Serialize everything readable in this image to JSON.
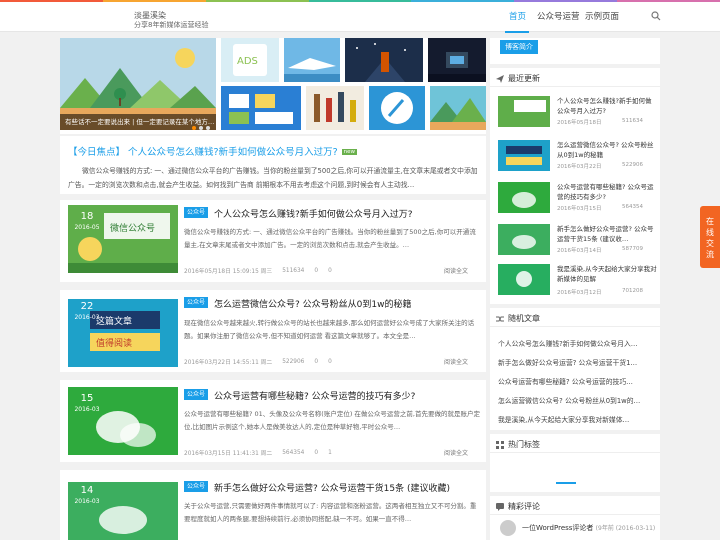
{
  "header": {
    "site_title": "淡墨溪染",
    "site_subtitle": "分享8年新媒体运营经验",
    "nav": [
      "首页",
      "公众号运营",
      "示例页面"
    ],
    "accent": "#1a9ee8"
  },
  "banner": {
    "caption": "有些话不一定要说出来 | 但一定要记录在某个地方…"
  },
  "focus": {
    "title": "【今日焦点】 个人公众号怎么赚钱?新手如何做公众号月入过万?",
    "badge": "new",
    "text": "微信公众号赚钱的方式: 一、通过微信公众平台的广告赚钱。当你的粉丝量到了500之后,你可以开通流量主,在文章末尾或者文中添加广告。一定的浏览次数和点击,就会产生收益。如何找到广告商 前期根本不用去考虑这个问题,到时候会有人主动找…"
  },
  "articles": [
    {
      "day": "18",
      "ym": "2016-05",
      "category": "公众号",
      "title": "个人公众号怎么赚钱?新手如何做公众号月入过万?",
      "excerpt": "微信公众号赚钱的方式: 一、通过微信公众平台的广告赚钱。当你的粉丝量到了500之后,你可以开通流量主,在文章末尾或者文中添加广告。一定的浏览次数和点击,就会产生收益。…",
      "date": "2016年05月18日 15:09:15 周三",
      "views": "511634",
      "comments": "0",
      "likes": "0",
      "more": "阅读全文"
    },
    {
      "day": "22",
      "ym": "2016-03",
      "category": "公众号",
      "title": "怎么运营微信公众号? 公众号粉丝从0到1w的秘籍",
      "excerpt": "现在微信公众号越来越火,转行做公众号的站长也越来越多,那么如何运营好公众号成了大家所关注的话题。如果你注册了微信公众号,但不知道如何运营 看这篇文章就够了。本文全是…",
      "date": "2016年03月22日 14:55:11 周二",
      "views": "522906",
      "comments": "0",
      "likes": "0",
      "more": "阅读全文"
    },
    {
      "day": "15",
      "ym": "2016-03",
      "category": "公众号",
      "title": "公众号运营有哪些秘籍? 公众号运营的技巧有多少?",
      "excerpt": "公众号运营有哪些秘籍? 01、头像及公众号名称(账户定位) 在做公众号运营之前,首先要做的就是账户定位,比如图片示例这个,她本人是做美妆达人的,定位是种草好物,平时公众号…",
      "date": "2016年03月15日 11:41:31 周二",
      "views": "564354",
      "comments": "0",
      "likes": "1",
      "more": "阅读全文"
    },
    {
      "day": "14",
      "ym": "2016-03",
      "category": "公众号",
      "title": "新手怎么做好公众号运营? 公众号运营干货15条 (建议收藏)",
      "excerpt": "关于公众号运营,只需要做好两件事情就可以了: 内容运营和涨粉运营。这两者相互独立又不可分割。重要程度就如人的两条腿,要想持续前行,必须协同搭配,缺一不可。如果一直不得…",
      "date": "2016年03月14日",
      "views": "",
      "comments": "",
      "likes": "",
      "more": ""
    }
  ],
  "sidebar": {
    "blog_intro": "博客简介",
    "recent_heading": "最近更新",
    "recent": [
      {
        "title": "个人公众号怎么赚钱?新手如何做公众号月入过万?",
        "date": "2016年05月18日",
        "views": "511634"
      },
      {
        "title": "怎么运营微信公众号? 公众号粉丝从0到1w的秘籍",
        "date": "2016年03月22日",
        "views": "522906"
      },
      {
        "title": "公众号运营有哪些秘籍? 公众号运营的技巧有多少?",
        "date": "2016年03月15日",
        "views": "564354"
      },
      {
        "title": "新手怎么做好公众号运营? 公众号运营干货15条 (建议收…",
        "date": "2016年03月14日",
        "views": "587709"
      },
      {
        "title": "我是溪染,从今天起给大家分享我对新媒体的见解",
        "date": "2016年03月12日",
        "views": "701208"
      }
    ],
    "random_heading": "随机文章",
    "random": [
      "个人公众号怎么赚钱?新手如何做公众号月入…",
      "新手怎么做好公众号运营? 公众号运营干货1…",
      "公众号运营有哪些秘籍? 公众号运营的技巧…",
      "怎么运营微信公众号? 公众号粉丝从0到1w的…",
      "我是溪染,从今天起给大家分享我对新媒体…"
    ],
    "tags_heading": "热门标签",
    "comments_heading": "精彩评论",
    "comment_author": "一位WordPress评论者",
    "comment_meta": "(9年前 (2016-03-11)"
  },
  "float_tab": [
    "在",
    "线",
    "交",
    "流"
  ]
}
